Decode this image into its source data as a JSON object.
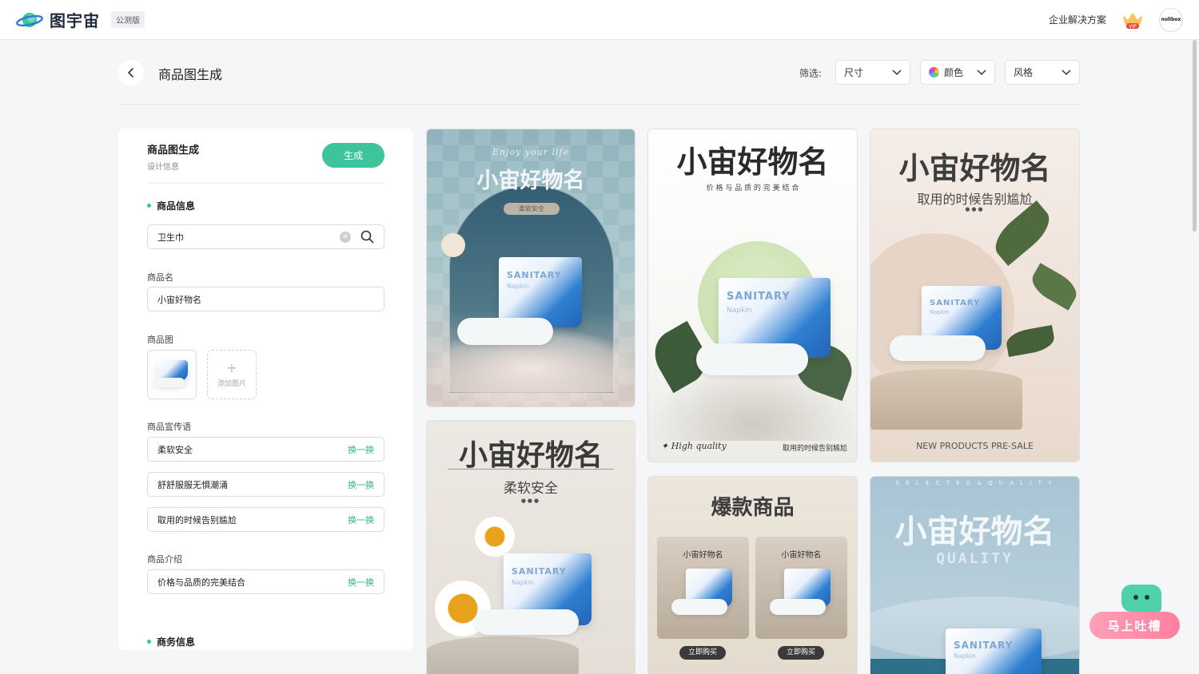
{
  "app": {
    "name": "图宇宙",
    "badge": "公测版"
  },
  "topbar": {
    "enterprise": "企业解决方案",
    "vip": "VIP",
    "avatar": "nolibox"
  },
  "header": {
    "title": "商品图生成",
    "filter_label": "筛选:"
  },
  "filters": [
    {
      "label": "尺寸"
    },
    {
      "label": "颜色"
    },
    {
      "label": "风格"
    }
  ],
  "panel": {
    "title": "商品图生成",
    "subtitle": "设计信息",
    "generate": "生成",
    "section_product": "商品信息",
    "search_value": "卫生巾",
    "name_label": "商品名",
    "name_value": "小宙好物名",
    "image_label": "商品图",
    "add_image": "添加图片",
    "slogan_label": "商品宣传语",
    "slogans": [
      "柔软安全",
      "舒舒服服无惧潮涌",
      "取用的时候告别尴尬"
    ],
    "swap": "换一换",
    "intro_label": "商品介绍",
    "intro_value": "价格与品质的完美结合",
    "section_business": "商务信息"
  },
  "cards": {
    "c1": {
      "script": "Enjoy your life",
      "headline": "小宙好物名",
      "tag": "柔软安全"
    },
    "c2": {
      "headline": "小宙好物名",
      "tagline": "价 格 与 品 质 的 完 美 结 合",
      "footer_left": "✦ High quality",
      "footer_right": "取用的时候告别尴尬"
    },
    "c3": {
      "headline": "小宙好物名",
      "tagline": "取用的时候告别尴尬",
      "dots": "●●●",
      "footer": "NEW PRODUCTS PRE-SALE"
    },
    "c4": {
      "headline": "小宙好物名",
      "tagline": "柔软安全",
      "dots": "●●●"
    },
    "c5": {
      "headline": "爆款商品",
      "item_title": "小宙好物名",
      "buy": "立即购买"
    },
    "c6": {
      "letters": "S E L E C T E D & Q U A L I T Y",
      "headline": "小宙好物名",
      "sub": "QUALITY"
    }
  },
  "pack": {
    "brand": "SANITARY",
    "sub": "Napkin"
  },
  "feedback": {
    "label": "马上吐槽"
  }
}
